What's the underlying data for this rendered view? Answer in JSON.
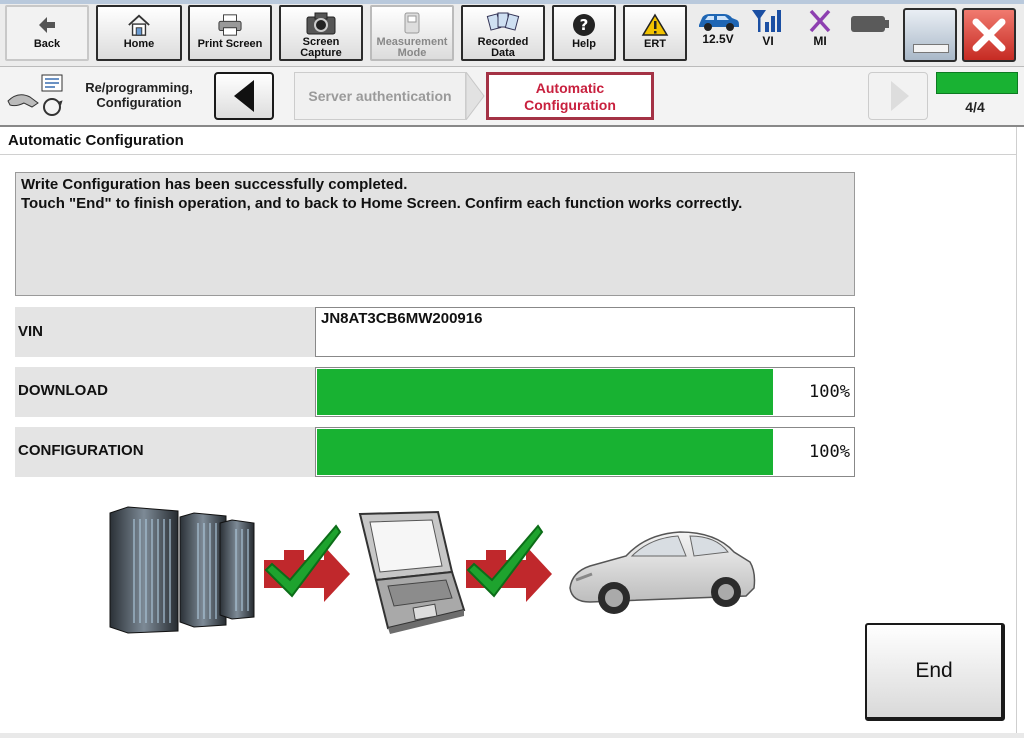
{
  "toolbar": {
    "back": "Back",
    "home": "Home",
    "print_screen": "Print Screen",
    "screen_capture": [
      "Screen",
      "Capture"
    ],
    "measurement_mode": [
      "Measurement",
      "Mode"
    ],
    "recorded_data": [
      "Recorded",
      "Data"
    ],
    "help": "Help",
    "ert": "ERT"
  },
  "status": {
    "voltage": "12.5V",
    "vi": "VI",
    "mi": "MI"
  },
  "breadcrumb": {
    "label": [
      "Re/programming,",
      "Configuration"
    ],
    "steps": [
      {
        "label": "Server authentication"
      },
      {
        "label": [
          "Automatic",
          "Configuration"
        ]
      }
    ],
    "page": "4/4",
    "progress": 1.0
  },
  "section": {
    "title": "Automatic Configuration"
  },
  "message": {
    "line1": "Write Configuration has been successfully completed.",
    "line2": "Touch \"End\" to finish operation, and to back to Home Screen. Confirm each function works correctly."
  },
  "rows": {
    "vin_label": "VIN",
    "vin_value": "JN8AT3CB6MW200916",
    "download_label": "DOWNLOAD",
    "download_pct": "100%",
    "download_progress": 1.0,
    "configuration_label": "CONFIGURATION",
    "configuration_pct": "100%",
    "configuration_progress": 1.0
  },
  "actions": {
    "end": "End"
  },
  "colors": {
    "progress_green": "#18b232",
    "active_step_border": "#a43245",
    "active_step_text": "#c8203e",
    "close_red": "#d9413c",
    "check_green": "#1ea32e",
    "arrow_red": "#c0282c"
  }
}
